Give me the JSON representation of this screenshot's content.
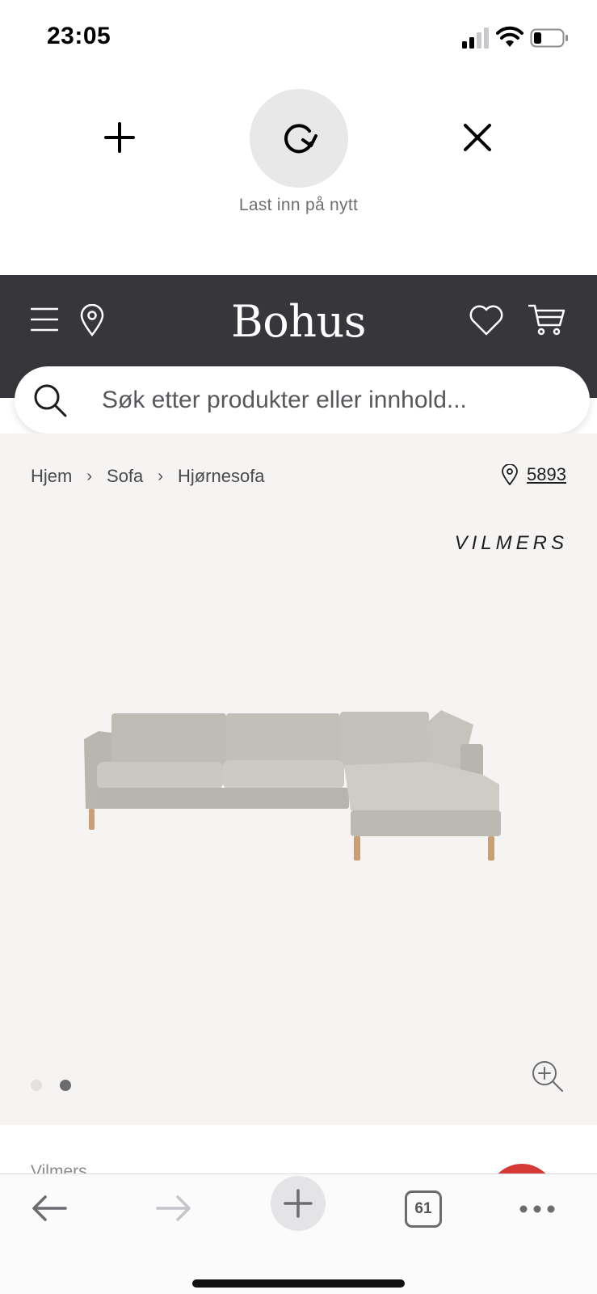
{
  "status_bar": {
    "time": "23:05",
    "icons": [
      "cellular-signal-icon",
      "wifi-icon",
      "battery-icon"
    ]
  },
  "pull_to_refresh": {
    "add_icon": "plus-icon",
    "reload_icon": "reload-icon",
    "close_icon": "close-icon",
    "label": "Last inn på nytt"
  },
  "header": {
    "logo": "Bohus",
    "menu_icon": "hamburger-menu-icon",
    "location_icon": "map-pin-icon",
    "wishlist_icon": "heart-icon",
    "cart_icon": "cart-icon",
    "background_color": "#37373b"
  },
  "search": {
    "placeholder": "Søk etter produkter eller innhold...",
    "value": ""
  },
  "breadcrumb": {
    "items": [
      "Hjem",
      "Sofa",
      "Hjørnesofa"
    ],
    "separator": "›"
  },
  "store": {
    "number": "5893"
  },
  "product": {
    "brand_logo": "VILMERS",
    "image_icon": "corner-sofa-image",
    "carousel": {
      "total": 2,
      "active_index": 1
    },
    "zoom_icon": "zoom-in-icon",
    "name_peek": "Vilmers",
    "background_color": "#f5f4f2"
  },
  "toolbar": {
    "tabs_count": "61",
    "icons": [
      "back-arrow-icon",
      "forward-arrow-icon",
      "plus-icon",
      "tabs-icon",
      "more-icon"
    ]
  }
}
